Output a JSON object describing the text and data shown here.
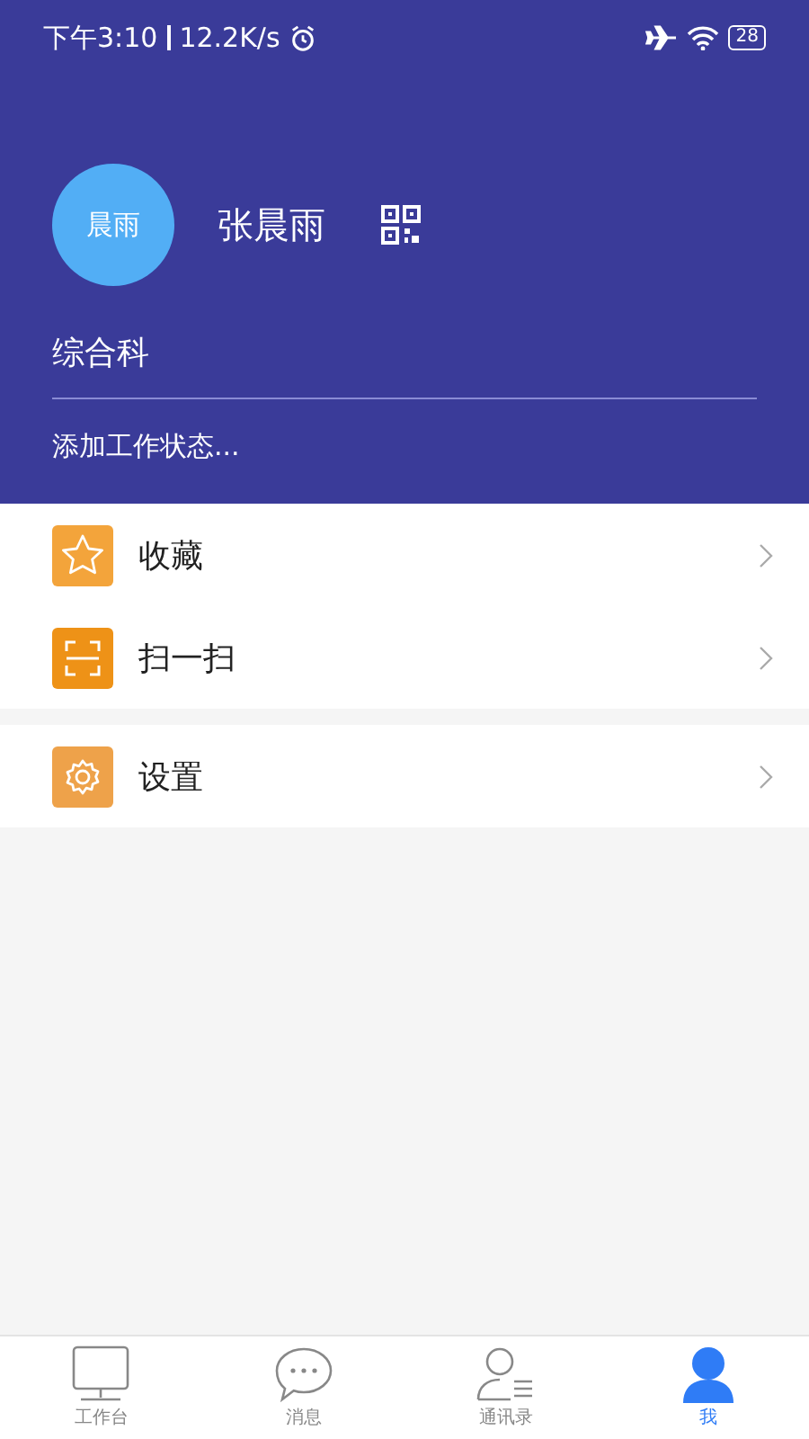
{
  "status_bar": {
    "time": "下午3:10",
    "speed": "12.2K/s",
    "battery": "28"
  },
  "profile": {
    "avatar_text": "晨雨",
    "name": "张晨雨",
    "department": "综合科",
    "status_placeholder": "添加工作状态..."
  },
  "menu_groups": [
    [
      {
        "label": "收藏",
        "kind": "star"
      },
      {
        "label": "扫一扫",
        "kind": "scan"
      }
    ],
    [
      {
        "label": "设置",
        "kind": "gear"
      }
    ]
  ],
  "tabs": [
    {
      "label": "工作台",
      "kind": "desktop",
      "selected": false
    },
    {
      "label": "消息",
      "kind": "chat",
      "selected": false
    },
    {
      "label": "通讯录",
      "kind": "contacts",
      "selected": false
    },
    {
      "label": "我",
      "kind": "me",
      "selected": true
    }
  ]
}
